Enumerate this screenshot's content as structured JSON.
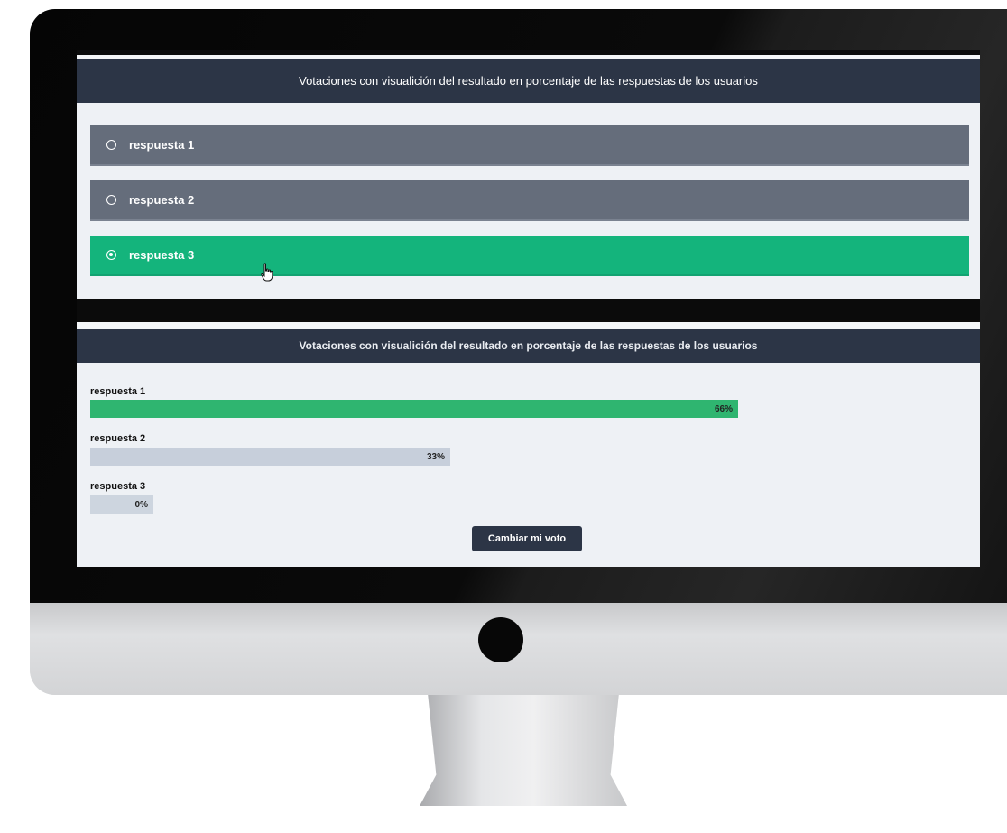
{
  "poll": {
    "title": "Votaciones con visualición del resultado en porcentaje de las respuestas de los usuarios",
    "options": [
      {
        "label": "respuesta 1",
        "selected": false
      },
      {
        "label": "respuesta 2",
        "selected": false
      },
      {
        "label": "respuesta 3",
        "selected": true
      }
    ]
  },
  "results": {
    "title": "Votaciones con visualición del resultado en porcentaje de las respuestas de los usuarios",
    "items": [
      {
        "label": "respuesta 1",
        "percent_text": "66%",
        "percent": 66
      },
      {
        "label": "respuesta 2",
        "percent_text": "33%",
        "percent": 33
      },
      {
        "label": "respuesta 3",
        "percent_text": "0%",
        "percent": 0
      }
    ],
    "change_vote_label": "Cambiar mi voto"
  },
  "colors": {
    "header": "#2c3546",
    "selected_option": "#14b47c",
    "unselected_option": "#656d7b",
    "winning_bar": "#2fb570",
    "other_bar": "#c7cfdb"
  }
}
